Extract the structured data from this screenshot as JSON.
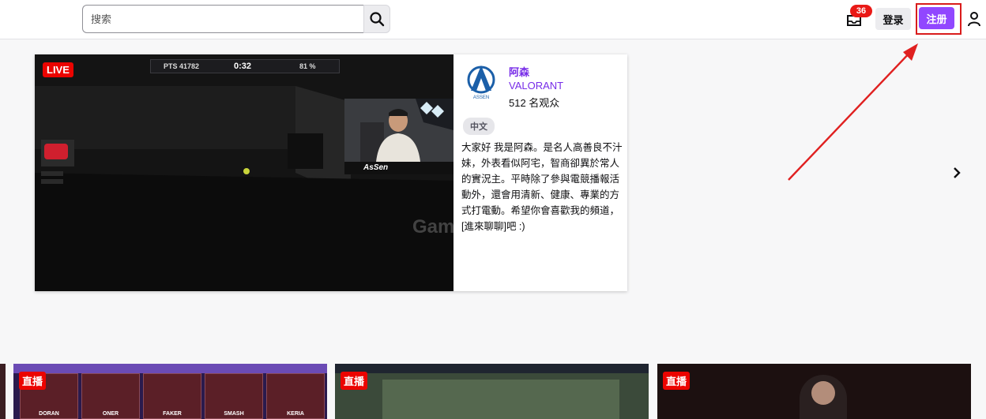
{
  "header": {
    "search_placeholder": "搜索",
    "notification_count": "36",
    "login_label": "登录",
    "signup_label": "注册"
  },
  "colors": {
    "brand_purple": "#9147ff",
    "live_red": "#eb0400",
    "annotation_red": "#d91c1c"
  },
  "featured": {
    "live_label": "LIVE",
    "hud": {
      "pts": "PTS 41782",
      "time": "0:32",
      "pct": "81 %"
    },
    "webcam_name": "AsSen",
    "channel_name": "阿森",
    "game": "VALORANT",
    "viewers": "512 名观众",
    "tag": "中文",
    "description": "大家好 我是阿森。是名人高善良不汁妹，外表看似阿宅，智商卻異於常人的實況主。平時除了參與電競播報活動外，還會用清新、健康、專業的方式打電動。希望你會喜歡我的頻道，[進來聊聊]吧 :)",
    "watermark": "GamBoom"
  },
  "cards": [
    {
      "live_label": "直播",
      "players": [
        "DORAN",
        "ONER",
        "FAKER",
        "SMASH",
        "KERIA"
      ]
    },
    {
      "live_label": "直播"
    },
    {
      "live_label": "直播"
    }
  ],
  "icons": [
    "search-icon",
    "inbox-icon",
    "user-icon",
    "chevron-right-icon",
    "annotation-arrow"
  ]
}
